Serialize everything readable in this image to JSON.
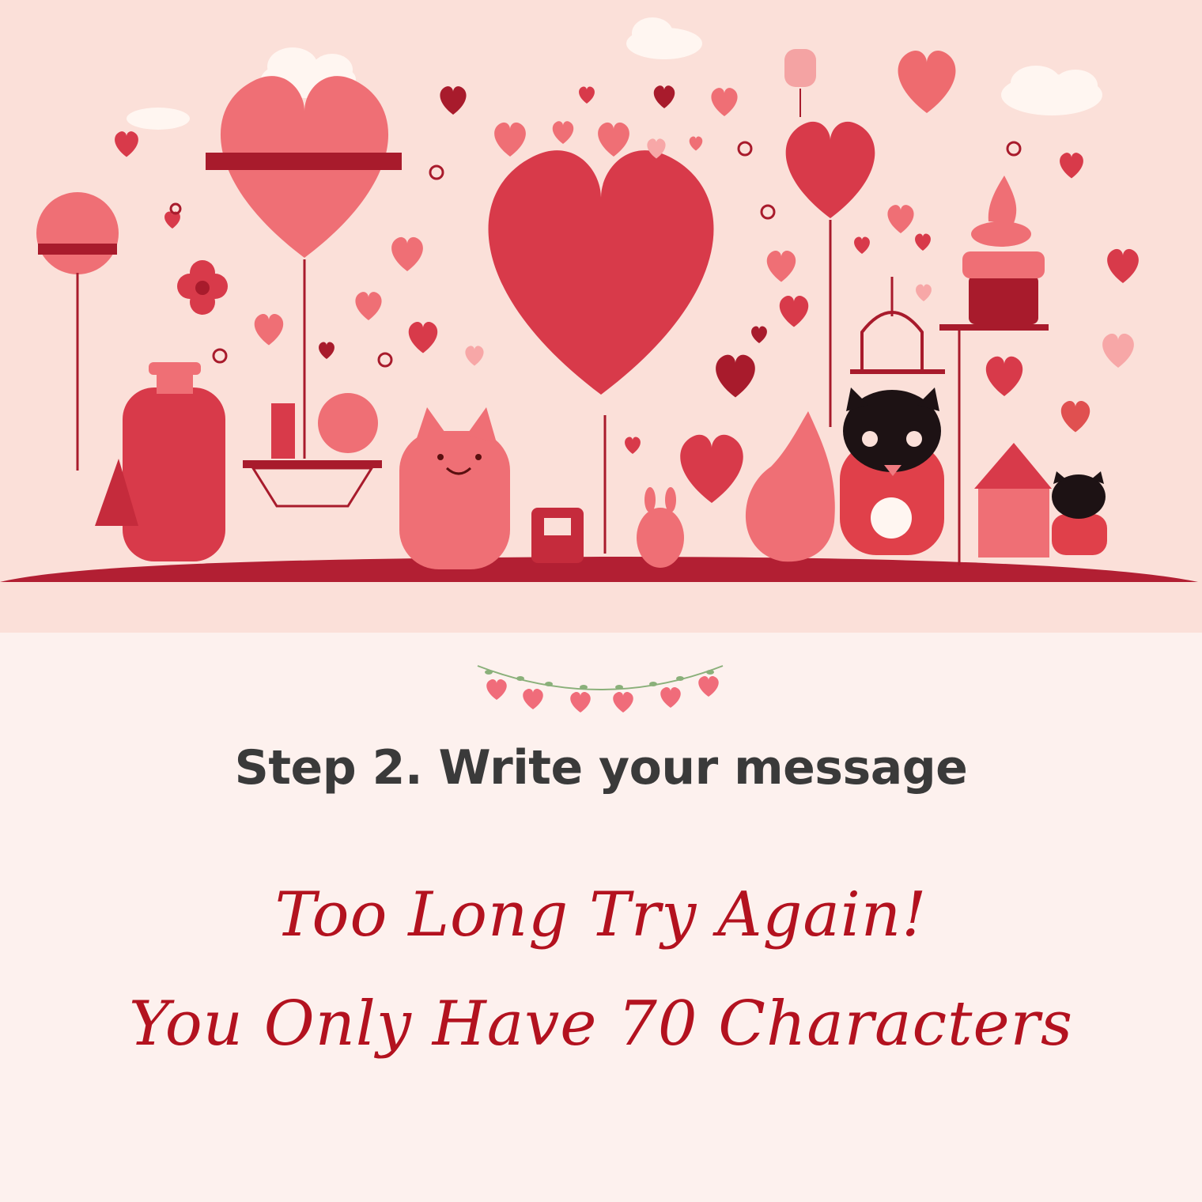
{
  "hero": {
    "illustration": "valentine-hearts-characters-illustration",
    "background_color": "#fbe0d9"
  },
  "decoration": {
    "garland_icon": "heart-garland-icon"
  },
  "step": {
    "title": "Step 2. Write your message"
  },
  "error": {
    "line1": "Too Long Try Again!",
    "line2": "You Only Have 70 Characters",
    "color": "#b3121f"
  },
  "theme": {
    "page_background": "#fdf1ee",
    "heart_red": "#d83a4a",
    "heart_pink": "#f07a80",
    "ground": "#b21f33"
  }
}
